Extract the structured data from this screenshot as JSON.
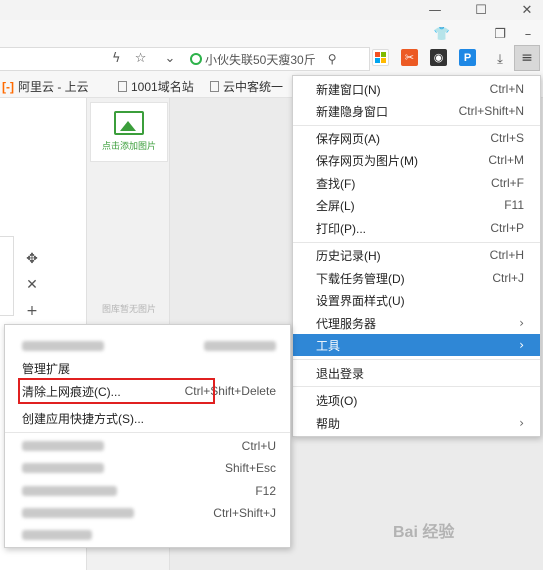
{
  "window": {
    "minimize_icon": "minimize-icon",
    "maximize_icon": "maximize-icon",
    "close_icon": "close-icon"
  },
  "toolbar": {
    "search_text": "小伙失联50天瘦30斤",
    "icons": [
      "shirt-icon",
      "restore-icon",
      "lightning-icon",
      "star-icon",
      "chevron-down-icon",
      "search-icon",
      "download-icon",
      "menu-icon"
    ],
    "extensions": [
      {
        "name": "windows-logo-icon",
        "color": "#e8e8e8"
      },
      {
        "name": "tools-extension-icon",
        "color": "#ec5a24"
      },
      {
        "name": "camera-extension-icon",
        "color": "#333333"
      },
      {
        "name": "p-extension-icon",
        "color": "#1e88e5",
        "label": "P"
      }
    ]
  },
  "bookmarks": [
    {
      "label": "阿里云 - 上云"
    },
    {
      "label": "1001域名站"
    },
    {
      "label": "云中客统一"
    }
  ],
  "page": {
    "add_image_label": "点击添加图片",
    "gallery_empty": "图库暂无图片",
    "watermark": "Bai 经验"
  },
  "menu": {
    "items": [
      {
        "label": "新建窗口(N)",
        "shortcut": "Ctrl+N"
      },
      {
        "label": "新建隐身窗口",
        "shortcut": "Ctrl+Shift+N"
      },
      {
        "label": "保存网页(A)",
        "shortcut": "Ctrl+S"
      },
      {
        "label": "保存网页为图片(M)",
        "shortcut": "Ctrl+M"
      },
      {
        "label": "查找(F)",
        "shortcut": "Ctrl+F"
      },
      {
        "label": "全屏(L)",
        "shortcut": "F11"
      },
      {
        "label": "打印(P)...",
        "shortcut": "Ctrl+P"
      },
      {
        "label": "历史记录(H)",
        "shortcut": "Ctrl+H"
      },
      {
        "label": "下载任务管理(D)",
        "shortcut": "Ctrl+J"
      },
      {
        "label": "设置界面样式(U)",
        "shortcut": ""
      },
      {
        "label": "代理服务器",
        "shortcut": ""
      },
      {
        "label": "工具",
        "shortcut": ""
      },
      {
        "label": "退出登录",
        "shortcut": ""
      },
      {
        "label": "选项(O)",
        "shortcut": ""
      },
      {
        "label": "帮助",
        "shortcut": ""
      }
    ],
    "active_color": "#2f87d6"
  },
  "submenu": {
    "items": [
      {
        "label": "管理扩展",
        "shortcut": ""
      },
      {
        "label": "清除上网痕迹(C)...",
        "shortcut": "Ctrl+Shift+Delete"
      },
      {
        "label": "创建应用快捷方式(S)...",
        "shortcut": ""
      },
      {
        "label": "",
        "shortcut": "Ctrl+U"
      },
      {
        "label": "",
        "shortcut": "Shift+Esc"
      },
      {
        "label": "",
        "shortcut": "F12"
      },
      {
        "label": "",
        "shortcut": "Ctrl+Shift+J"
      }
    ],
    "highlight_color": "#e02020"
  }
}
